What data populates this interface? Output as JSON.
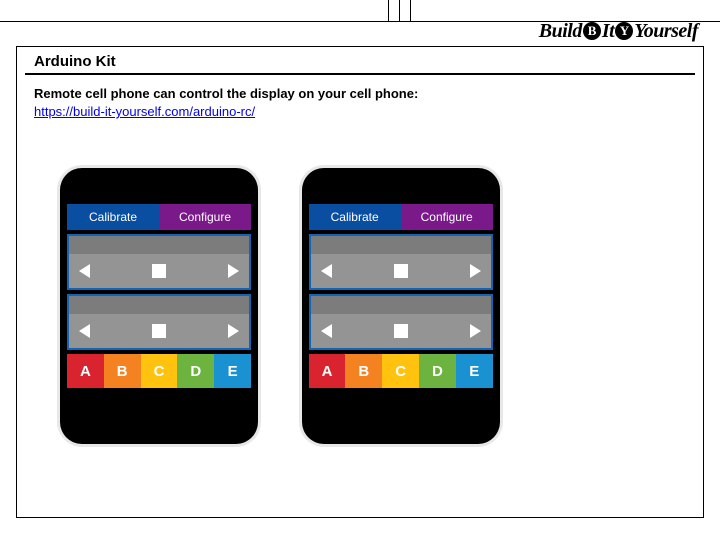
{
  "logo": {
    "part1": "Build",
    "dot1": "B",
    "part2": "It",
    "dot2": "Y",
    "part3": "Yourself"
  },
  "page": {
    "title": "Arduino Kit",
    "description": "Remote cell phone can control the display on your cell phone:",
    "link_text": "https://build-it-yourself.com/arduino-rc/",
    "link_href": "https://build-it-yourself.com/arduino-rc/"
  },
  "phone_ui": {
    "tabs": {
      "calibrate": "Calibrate",
      "configure": "Configure"
    },
    "buttons": {
      "a": "A",
      "b": "B",
      "c": "C",
      "d": "D",
      "e": "E"
    }
  }
}
